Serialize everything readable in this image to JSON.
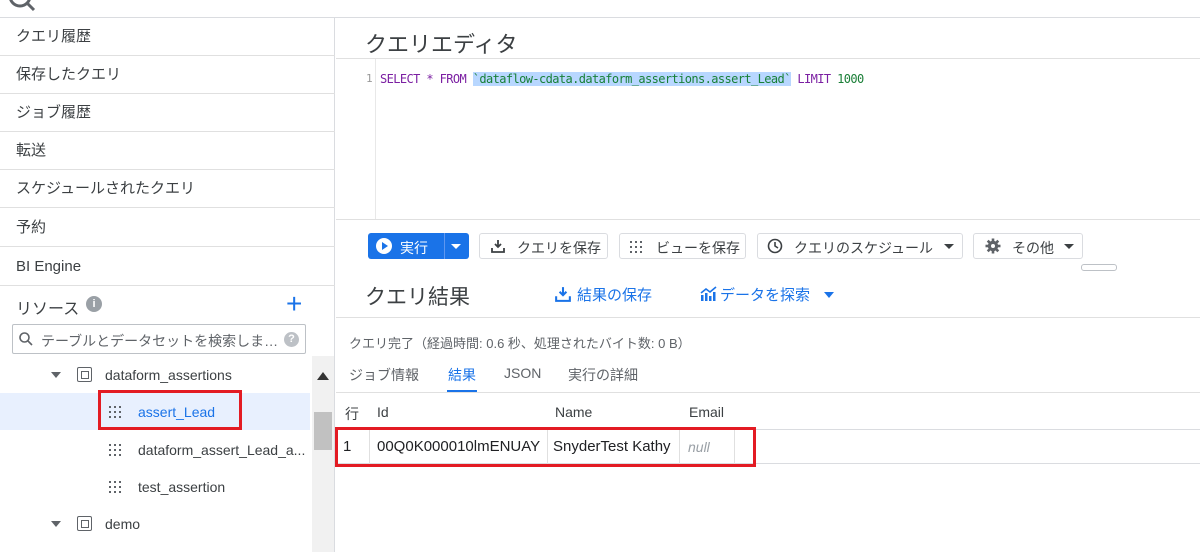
{
  "sidebar": {
    "items": [
      {
        "label": "クエリ履歴"
      },
      {
        "label": "保存したクエリ"
      },
      {
        "label": "ジョブ履歴"
      },
      {
        "label": "転送"
      },
      {
        "label": "スケジュールされたクエリ"
      },
      {
        "label": "予約"
      },
      {
        "label": "BI Engine"
      }
    ],
    "resources_title": "リソース",
    "search_placeholder": "テーブルとデータセットを検索しま…",
    "tree": [
      {
        "label": "dataform_assertions",
        "type": "dataset",
        "expanded": true
      },
      {
        "label": "assert_Lead",
        "type": "table",
        "selected": true
      },
      {
        "label": "dataform_assert_Lead_a...",
        "type": "table"
      },
      {
        "label": "test_assertion",
        "type": "table"
      },
      {
        "label": "demo",
        "type": "dataset",
        "expanded": true
      }
    ]
  },
  "editor": {
    "title": "クエリエディタ",
    "line_number": "1",
    "code": {
      "kw1": "SELECT * FROM ",
      "table": "`dataflow-cdata.dataform_assertions.assert_Lead`",
      "kw2": " LIMIT ",
      "limit": "1000"
    }
  },
  "toolbar": {
    "run_label": "実行",
    "save_query_label": "クエリを保存",
    "save_view_label": "ビューを保存",
    "schedule_label": "クエリのスケジュール",
    "more_label": "その他"
  },
  "results": {
    "title": "クエリ結果",
    "save_results_label": "結果の保存",
    "explore_label": "データを探索",
    "status": "クエリ完了（経過時間: 0.6 秒、処理されたバイト数: 0 B）",
    "tabs": [
      {
        "label": "ジョブ情報",
        "active": false
      },
      {
        "label": "結果",
        "active": true
      },
      {
        "label": "JSON",
        "active": false
      },
      {
        "label": "実行の詳細",
        "active": false
      }
    ],
    "columns": [
      "行",
      "Id",
      "Name",
      "Email"
    ],
    "rows": [
      [
        "1",
        "00Q0K000010lmENUAY",
        "SnyderTest Kathy",
        "null"
      ]
    ]
  },
  "colors": {
    "accent": "#1a73e8",
    "highlight_box": "#e31b23",
    "selected_row": "#e8f0fe"
  }
}
